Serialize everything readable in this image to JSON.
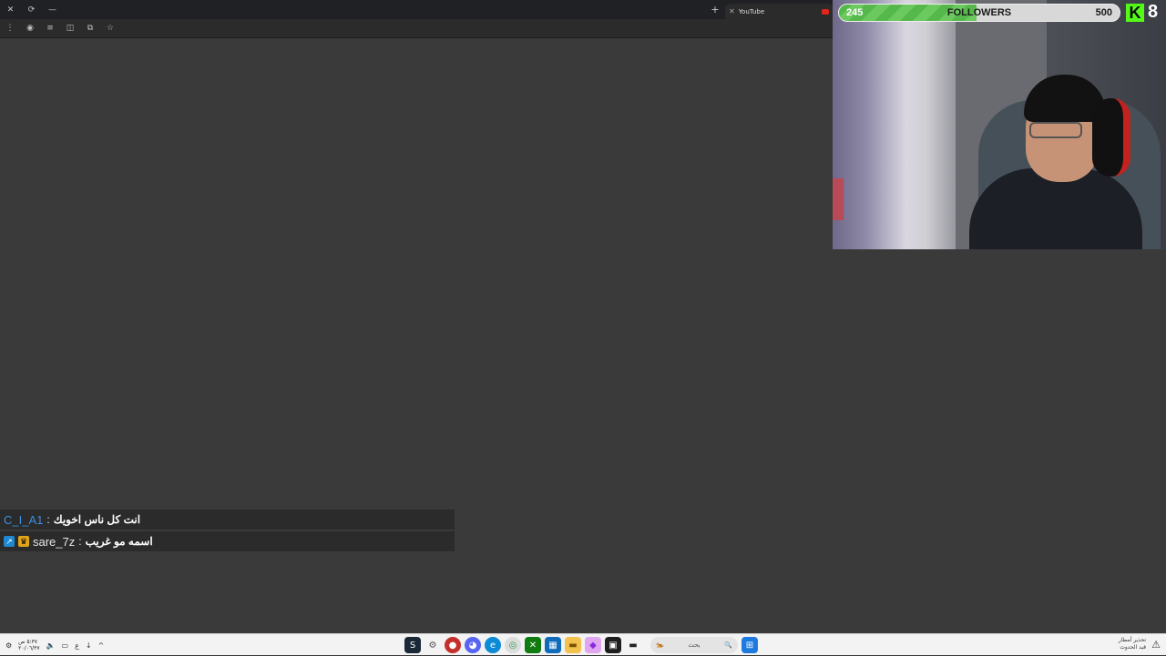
{
  "browser": {
    "tab_title": "YouTube",
    "new_tab_symbol": "+",
    "close_symbol": "✕",
    "window_controls": [
      "✕",
      "⟳",
      "—"
    ],
    "toolbar_icons": [
      "menu-icon",
      "extension-icon",
      "filter-icon",
      "sidebar-icon",
      "screenshot-icon",
      "star-icon"
    ],
    "youtube_color": "#e1251b"
  },
  "follower_goal": {
    "current": "245",
    "label": "FOLLOWERS",
    "target": "500",
    "fill_fraction": 0.49,
    "color": "#55b84a"
  },
  "kick_overlay": {
    "logo_letter": "K",
    "count": "8",
    "color": "#53fc18"
  },
  "chat": {
    "messages": [
      {
        "user": "C_I_A1",
        "separator": ":",
        "text": "انت كل ناس اخويك",
        "user_color": "#3d8ee0",
        "badges": []
      },
      {
        "user": "sare_7z",
        "separator": ":",
        "text": "اسمه مو غريب",
        "user_color": "#e6e6e6",
        "badges": [
          "blue",
          "gold"
        ]
      }
    ]
  },
  "taskbar": {
    "search_placeholder": "بحث",
    "clock_time": "٥:٣٧ ص",
    "clock_date": "٢٠/٠٦/٣٧",
    "weather_line1": "تحذير أمطار",
    "weather_line2": "قيد الحدوث",
    "apps": [
      "steam-icon",
      "settings-icon",
      "game-icon",
      "discord-icon",
      "edge-icon",
      "chrome-icon",
      "xbox-icon",
      "store-icon",
      "folder-icon",
      "app-icon",
      "terminal-icon",
      "window-icon"
    ],
    "start_color": "#1f7ae0"
  }
}
